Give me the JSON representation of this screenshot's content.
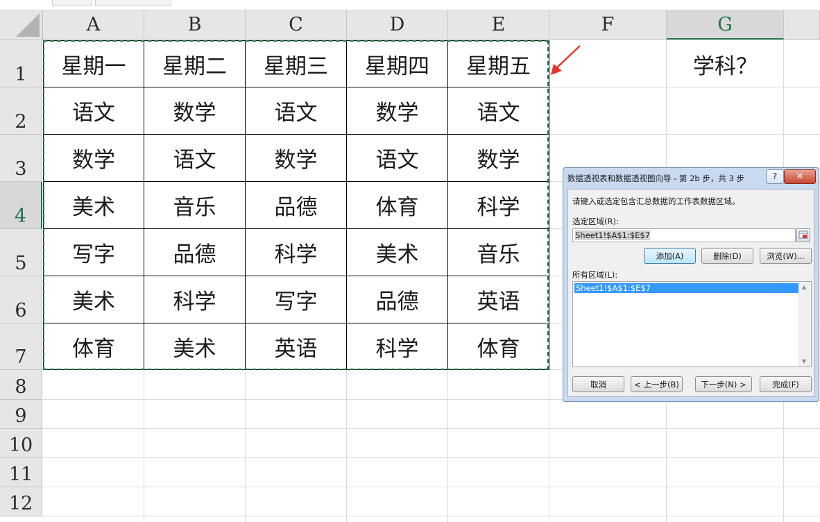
{
  "sheet": {
    "columns": [
      "A",
      "B",
      "C",
      "D",
      "E",
      "F",
      "G"
    ],
    "rows": [
      "1",
      "2",
      "3",
      "4",
      "5",
      "6",
      "7",
      "8",
      "9",
      "10",
      "11",
      "12"
    ],
    "selected_column": "G",
    "selected_row": "4",
    "table": [
      [
        "星期一",
        "星期二",
        "星期三",
        "星期四",
        "星期五"
      ],
      [
        "语文",
        "数学",
        "语文",
        "数学",
        "语文"
      ],
      [
        "数学",
        "语文",
        "数学",
        "语文",
        "数学"
      ],
      [
        "美术",
        "音乐",
        "品德",
        "体育",
        "科学"
      ],
      [
        "写字",
        "品德",
        "科学",
        "美术",
        "音乐"
      ],
      [
        "美术",
        "科学",
        "写字",
        "品德",
        "英语"
      ],
      [
        "体育",
        "美术",
        "英语",
        "科学",
        "体育"
      ]
    ],
    "g1": "学科？"
  },
  "dialog": {
    "title": "数据透视表和数据透视图向导 - 第 2b 步，共 3 步",
    "help": "?",
    "close": "✕",
    "instruction": "请键入或选定包含汇总数据的工作表数据区域。",
    "range_label": "选定区域(R):",
    "range_value": "Sheet1!$A$1:$E$7",
    "add": "添加(A)",
    "delete": "删除(D)",
    "browse": "浏览(W)...",
    "all_label": "所有区域(L):",
    "all_items": [
      "Sheet1!$A$1:$E$7"
    ],
    "cancel": "取消",
    "prev": "< 上一步(B)",
    "next": "下一步(N) >",
    "finish": "完成(F)"
  },
  "colors": {
    "accent_green": "#217346",
    "annotation_red": "#e8352b",
    "list_selection": "#3399ff"
  }
}
